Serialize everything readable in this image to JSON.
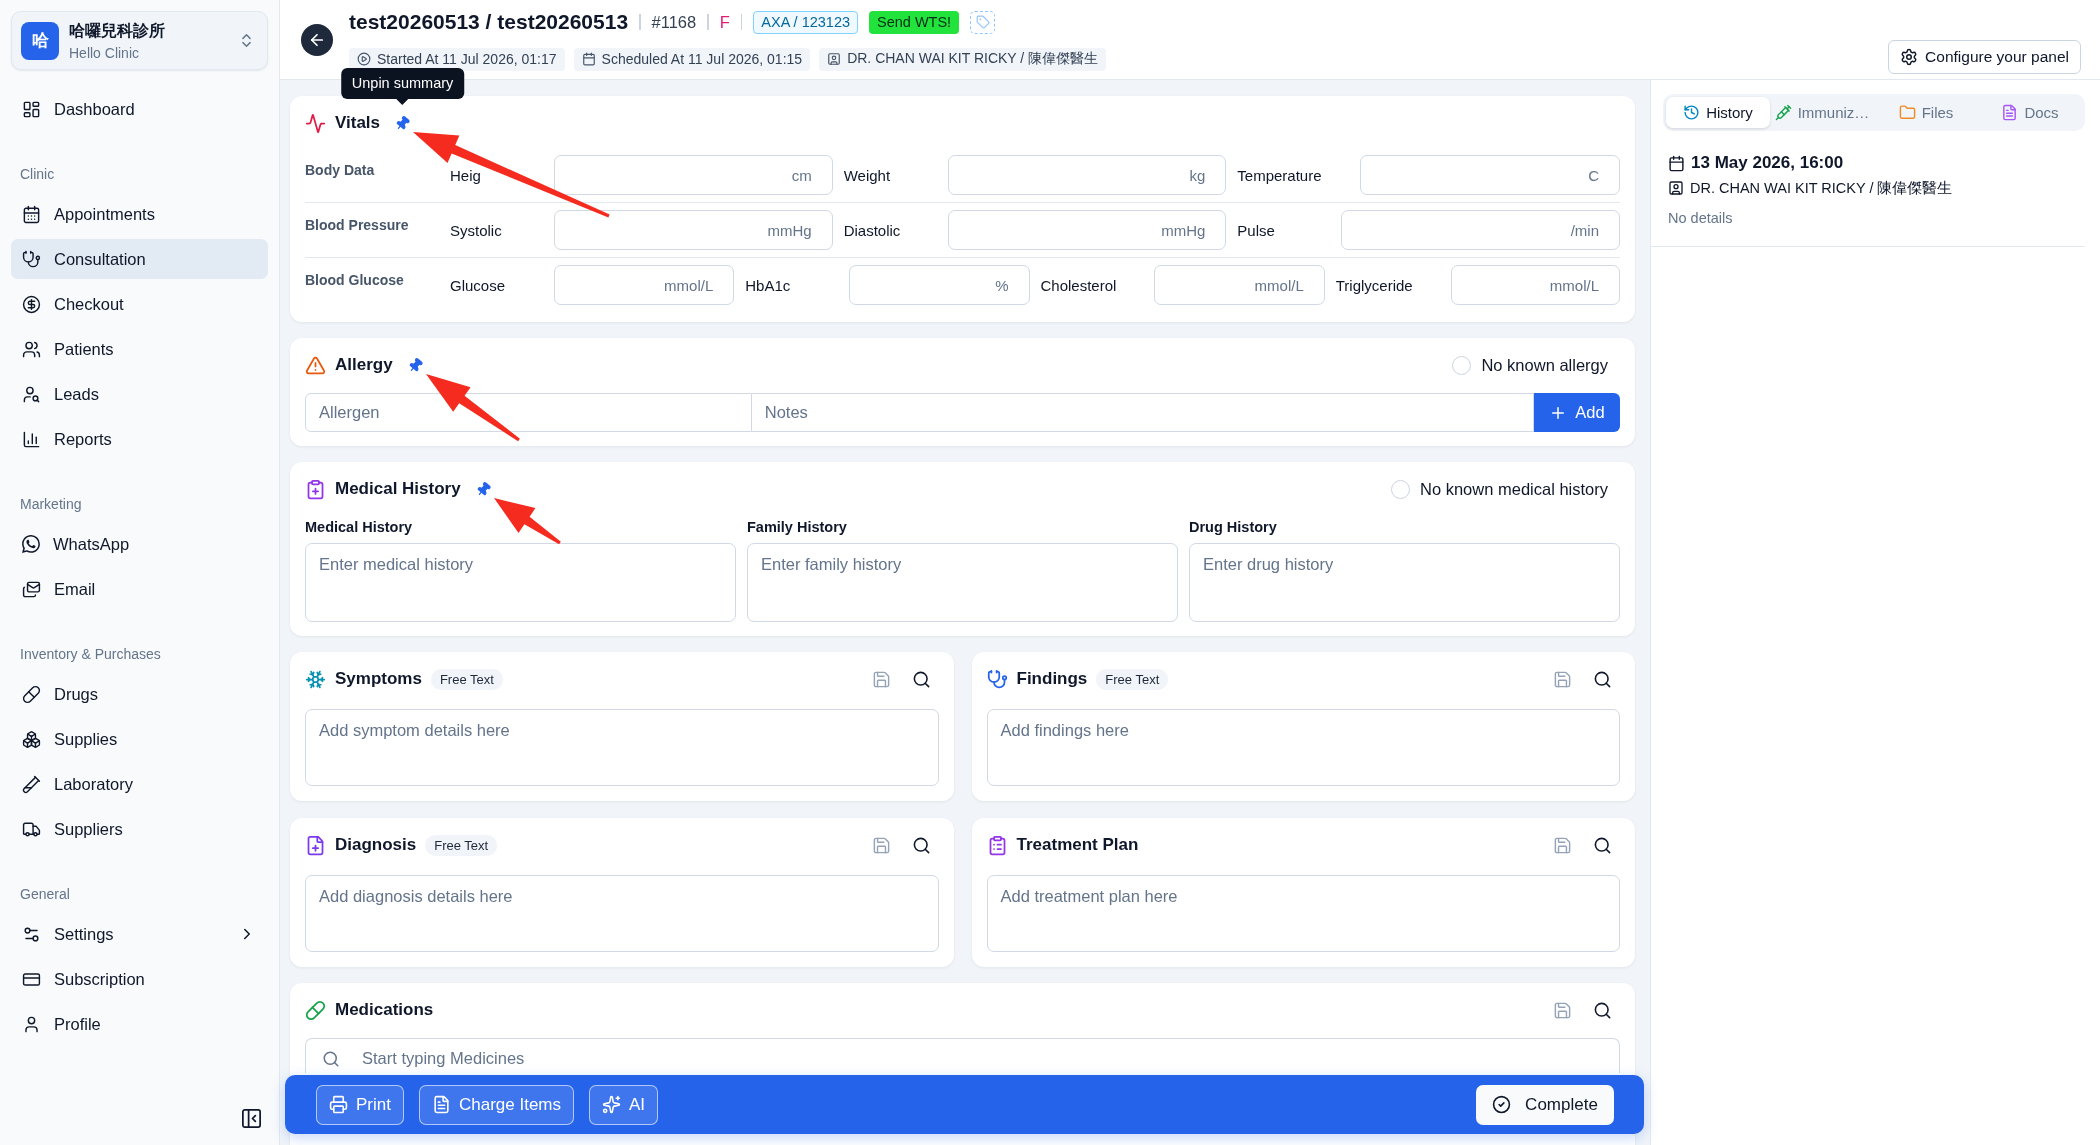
{
  "sidebar": {
    "clinic": {
      "logo": "哈",
      "name": "哈囉兒科診所",
      "subtitle": "Hello Clinic"
    },
    "sections": [
      {
        "items": [
          {
            "label": "Dashboard",
            "selected": false,
            "submenu": false
          }
        ]
      },
      {
        "title": "Clinic",
        "items": [
          {
            "label": "Appointments",
            "selected": false,
            "submenu": false
          },
          {
            "label": "Consultation",
            "selected": true,
            "submenu": false
          },
          {
            "label": "Checkout",
            "selected": false,
            "submenu": false
          },
          {
            "label": "Patients",
            "selected": false,
            "submenu": false
          },
          {
            "label": "Leads",
            "selected": false,
            "submenu": false
          },
          {
            "label": "Reports",
            "selected": false,
            "submenu": false
          }
        ]
      },
      {
        "title": "Marketing",
        "items": [
          {
            "label": "WhatsApp",
            "selected": false,
            "submenu": false
          },
          {
            "label": "Email",
            "selected": false,
            "submenu": false
          }
        ]
      },
      {
        "title": "Inventory & Purchases",
        "items": [
          {
            "label": "Drugs",
            "selected": false,
            "submenu": false
          },
          {
            "label": "Supplies",
            "selected": false,
            "submenu": false
          },
          {
            "label": "Laboratory",
            "selected": false,
            "submenu": false
          },
          {
            "label": "Suppliers",
            "selected": false,
            "submenu": false
          }
        ]
      },
      {
        "title": "General",
        "items": [
          {
            "label": "Settings",
            "selected": false,
            "submenu": true
          },
          {
            "label": "Subscription",
            "selected": false,
            "submenu": false
          },
          {
            "label": "Profile",
            "selected": false,
            "submenu": false
          }
        ]
      }
    ]
  },
  "header": {
    "title": "test20260513 / test20260513",
    "number": "#1168",
    "sex": "F",
    "insurance": "AXA / 123123",
    "send_button": "Send WTS!",
    "chips": [
      "Started At 11 Jul 2026, 01:17",
      "Scheduled At 11 Jul 2026, 01:15",
      "DR. CHAN WAI KIT RICKY / 陳偉傑醫生"
    ],
    "configure_button": "Configure your panel"
  },
  "vitals": {
    "title": "Vitals",
    "pinned": true,
    "tooltip": "Unpin summary",
    "groups": [
      {
        "label": "Body Data",
        "fields": [
          {
            "label": "Heig",
            "unit": "cm"
          },
          {
            "label": "Weight",
            "unit": "kg"
          },
          {
            "label": "Temperature",
            "unit": "C"
          }
        ]
      },
      {
        "label": "Blood Pressure",
        "fields": [
          {
            "label": "Systolic",
            "unit": "mmHg"
          },
          {
            "label": "Diastolic",
            "unit": "mmHg"
          },
          {
            "label": "Pulse",
            "unit": "/min"
          }
        ]
      },
      {
        "label": "Blood Glucose",
        "fields": [
          {
            "label": "Glucose",
            "unit": "mmol/L"
          },
          {
            "label": "HbA1c",
            "unit": "%"
          },
          {
            "label": "Cholesterol",
            "unit": "mmol/L"
          },
          {
            "label": "Triglyceride",
            "unit": "mmol/L"
          }
        ]
      }
    ]
  },
  "allergy": {
    "title": "Allergy",
    "pinned": true,
    "none_option": {
      "label": "No known allergy",
      "checked": false
    },
    "allergen_placeholder": "Allergen",
    "notes_placeholder": "Notes",
    "add_button": "Add"
  },
  "medical_history": {
    "title": "Medical History",
    "pinned": true,
    "none_option": {
      "label": "No known medical history",
      "checked": false
    },
    "fields": [
      {
        "label": "Medical History",
        "placeholder": "Enter medical history"
      },
      {
        "label": "Family History",
        "placeholder": "Enter family history"
      },
      {
        "label": "Drug History",
        "placeholder": "Enter drug history"
      }
    ]
  },
  "note_cards": [
    {
      "title": "Symptoms",
      "badge": "Free Text",
      "placeholder": "Add symptom details here"
    },
    {
      "title": "Findings",
      "badge": "Free Text",
      "placeholder": "Add findings here"
    },
    {
      "title": "Diagnosis",
      "badge": "Free Text",
      "placeholder": "Add diagnosis details here"
    },
    {
      "title": "Treatment Plan",
      "placeholder": "Add treatment plan here"
    }
  ],
  "medications": {
    "title": "Medications",
    "search_placeholder": "Start typing Medicines"
  },
  "action_bar": {
    "buttons": [
      "Print",
      "Charge Items",
      "AI"
    ],
    "complete_button": "Complete"
  },
  "right_panel": {
    "tabs": [
      {
        "label": "History",
        "selected": true
      },
      {
        "label": "Immuniz…",
        "selected": false
      },
      {
        "label": "Files",
        "selected": false
      },
      {
        "label": "Docs",
        "selected": false
      }
    ],
    "history": [
      {
        "date": "13 May 2026, 16:00",
        "doctor": "DR. CHAN WAI KIT RICKY / 陳偉傑醫生",
        "details": "No details"
      }
    ]
  }
}
